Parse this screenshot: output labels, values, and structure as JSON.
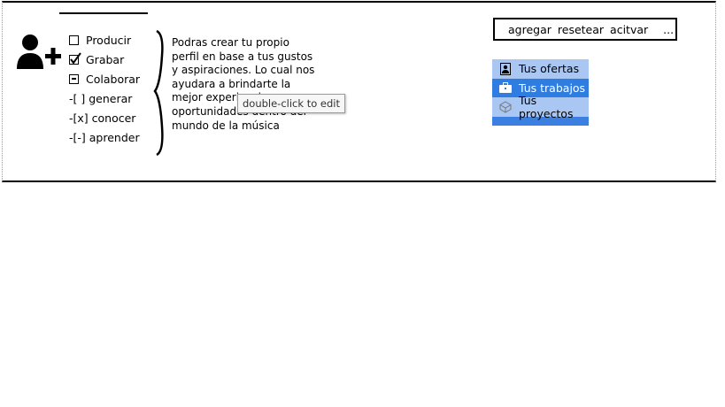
{
  "checklist": {
    "items": [
      {
        "label": "Producir",
        "state": "unchecked"
      },
      {
        "label": "Grabar",
        "state": "checked"
      },
      {
        "label": "Colaborar",
        "state": "indeterminate"
      }
    ],
    "text_items": [
      "-[ ] generar",
      "-[x] conocer",
      "-[-] aprender"
    ]
  },
  "description": {
    "lines": [
      "Podras crear tu propio",
      "perfil en base a tus gustos",
      "y aspiraciones. Lo cual nos",
      "ayudara a brindarte la",
      "mejor experiencia y",
      "oportunidades dentro del",
      "mundo de la música"
    ]
  },
  "tooltip": {
    "text": "double-click to edit"
  },
  "buttonbar": {
    "items": [
      "agregar",
      "resetear",
      "acitvar",
      "..."
    ]
  },
  "tabs": {
    "items": [
      {
        "label": "Tus ofertas",
        "icon": "contact-card-icon"
      },
      {
        "label": "Tus trabajos",
        "icon": "briefcase-icon"
      },
      {
        "label": "Tus proyectos",
        "icon": "cube-icon"
      }
    ],
    "selected": "Tus trabajos"
  },
  "colors": {
    "tab_active": "#2f7de1",
    "tab_light": "#a9c7f2",
    "tab_bg": "#3b7fe0"
  }
}
